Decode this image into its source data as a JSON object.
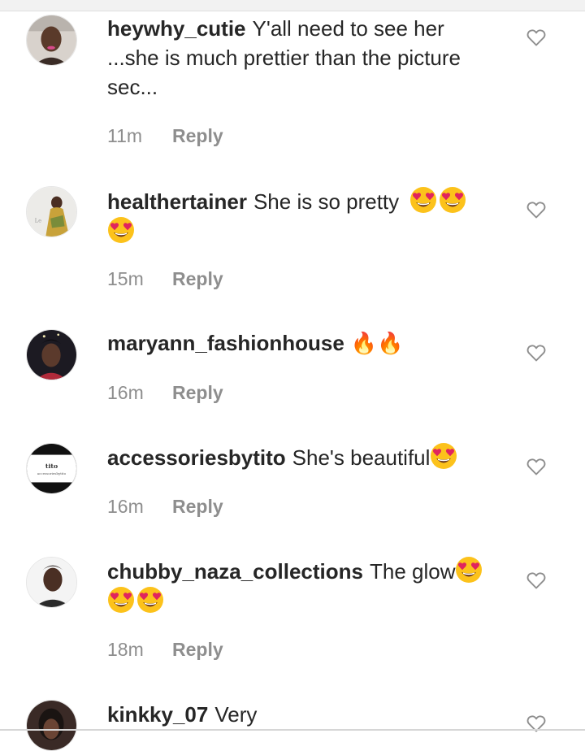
{
  "comments": [
    {
      "username": "heywhy_cutie",
      "text": "Y'all need to see her ...she is much prettier than the picture sec...",
      "time": "11m",
      "reply": "Reply",
      "avatar": "user-photo-woman-pink-lipstick"
    },
    {
      "username": "healthertainer",
      "text": "She is so pretty",
      "emojis": [
        "heart-eyes-emoji",
        "heart-eyes-emoji",
        "heart-eyes-emoji"
      ],
      "time": "15m",
      "reply": "Reply",
      "avatar": "user-photo-woman-floral-dress"
    },
    {
      "username": "maryann_fashionhouse",
      "text": "🔥🔥",
      "time": "16m",
      "reply": "Reply",
      "avatar": "user-photo-woman-dark-background"
    },
    {
      "username": "accessoriesbytito",
      "text": "She's beautiful",
      "emojis": [
        "heart-eyes-emoji"
      ],
      "time": "16m",
      "reply": "Reply",
      "avatar": "brand-logo-accessoriesbytito",
      "avatar_logo_line1": "tito",
      "avatar_logo_line2": "accessoriesbytito"
    },
    {
      "username": "chubby_naza_collections",
      "text": "The glow",
      "emojis": [
        "heart-eyes-emoji",
        "heart-eyes-emoji",
        "heart-eyes-emoji"
      ],
      "time": "18m",
      "reply": "Reply",
      "avatar": "user-photo-woman-white-background"
    },
    {
      "username": "kinkky_07",
      "text": "Very",
      "avatar": "user-photo-partial"
    }
  ],
  "colors": {
    "text": "#262626",
    "meta": "#8e8e8e",
    "icon": "#8e8e8e",
    "emoji_face": "#fcc21b",
    "emoji_heart": "#e0245e"
  },
  "icons": {
    "like": "heart-outline-icon"
  }
}
